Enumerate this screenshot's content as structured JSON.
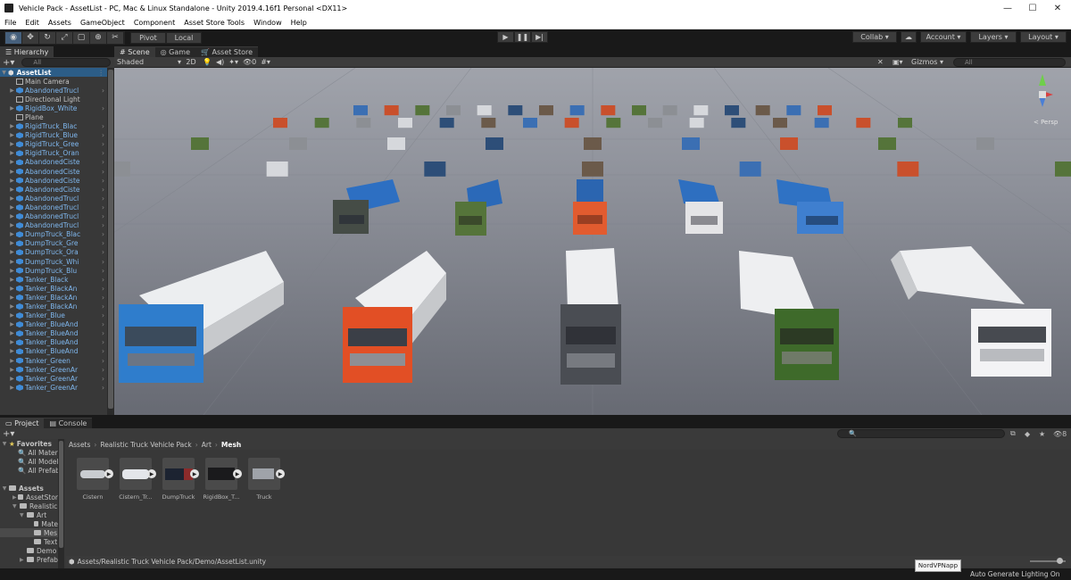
{
  "window": {
    "title": "Vehicle Pack - AssetList - PC, Mac & Linux Standalone - Unity 2019.4.16f1 Personal <DX11>"
  },
  "menu": [
    "File",
    "Edit",
    "Assets",
    "GameObject",
    "Component",
    "Asset Store Tools",
    "Window",
    "Help"
  ],
  "toolbar": {
    "pivot": "Pivot",
    "local": "Local",
    "collab": "Collab",
    "account": "Account",
    "layers": "Layers",
    "layout": "Layout"
  },
  "hierarchy": {
    "tab": "Hierarchy",
    "search_placeholder": "All",
    "root": "AssetList",
    "items": [
      "Main Camera",
      "AbandonedTrucl",
      "Directional Light",
      "RigidBox_White",
      "Plane",
      "RigidTruck_Blac",
      "RigidTruck_Blue",
      "RigidTruck_Gree",
      "RigidTruck_Oran",
      "AbandonedCiste",
      "AbandonedCiste",
      "AbandonedCiste",
      "AbandonedCiste",
      "AbandonedTrucl",
      "AbandonedTrucl",
      "AbandonedTrucl",
      "AbandonedTrucl",
      "DumpTruck_Blac",
      "DumpTruck_Gre",
      "DumpTruck_Ora",
      "DumpTruck_Whi",
      "DumpTruck_Blu",
      "Tanker_Black",
      "Tanker_BlackAn",
      "Tanker_BlackAn",
      "Tanker_BlackAn",
      "Tanker_Blue",
      "Tanker_BlueAnd",
      "Tanker_BlueAnd",
      "Tanker_BlueAnd",
      "Tanker_BlueAnd",
      "Tanker_Green",
      "Tanker_GreenAr",
      "Tanker_GreenAr",
      "Tanker_GreenAr"
    ]
  },
  "scene": {
    "tabs": [
      "Scene",
      "Game",
      "Asset Store"
    ],
    "shading": "Shaded",
    "mode2d": "2D",
    "gizmo_count": "0",
    "gizmos": "Gizmos",
    "search_placeholder": "All",
    "persp": "< Persp"
  },
  "project": {
    "tabs": [
      "Project",
      "Console"
    ],
    "favorites": "Favorites",
    "fav_items": [
      "All Materi",
      "All Model",
      "All Prefab"
    ],
    "assets": "Assets",
    "tree": [
      "AssetStor",
      "Realistic",
      "Art",
      "Mate",
      "Mes",
      "Text",
      "Demo",
      "Prefab"
    ],
    "breadcrumb": [
      "Assets",
      "Realistic Truck Vehicle Pack",
      "Art",
      "Mesh"
    ],
    "files": [
      "Cistern",
      "Cistern_Tr...",
      "DumpTruck",
      "RigidBox_T...",
      "Truck"
    ],
    "footer_path": "Assets/Realistic Truck Vehicle Pack/Demo/AssetList.unity",
    "hidden_count": "8"
  },
  "status": {
    "tooltip": "NordVPNapp",
    "lighting": "Auto Generate Lighting On"
  },
  "colors": {
    "sky": "#8a8d96",
    "ground": "#6e707a",
    "selection": "#2c5d87",
    "accent": "#46607c"
  }
}
